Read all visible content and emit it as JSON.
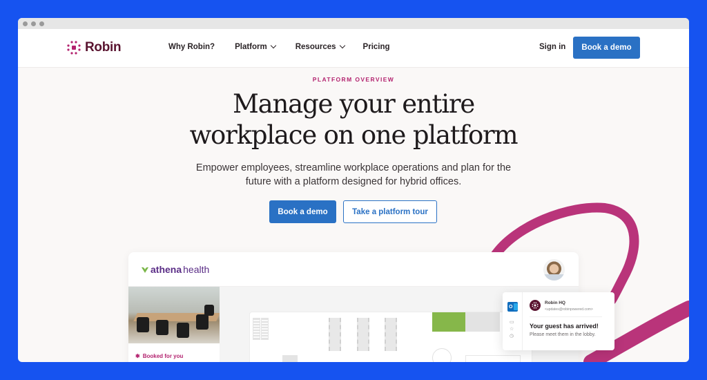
{
  "window": {
    "controls": [
      "close",
      "minimize",
      "maximize"
    ]
  },
  "nav": {
    "logo_text": "Robin",
    "links": [
      {
        "label": "Why Robin?",
        "has_dropdown": false
      },
      {
        "label": "Platform",
        "has_dropdown": true
      },
      {
        "label": "Resources",
        "has_dropdown": true
      },
      {
        "label": "Pricing",
        "has_dropdown": false
      }
    ],
    "sign_in": "Sign in",
    "cta": "Book a demo"
  },
  "hero": {
    "eyebrow": "PLATFORM OVERVIEW",
    "headline_line1": "Manage your entire",
    "headline_line2": "workplace on one platform",
    "subhead_line1": "Empower employees, streamline workplace operations and plan for the",
    "subhead_line2": "future with a platform designed for hybrid offices.",
    "primary_button": "Book a demo",
    "secondary_button": "Take a platform tour"
  },
  "app_preview": {
    "customer_logo_bold": "athena",
    "customer_logo_light": "health",
    "room_booking_label": "Booked for you",
    "notification": {
      "sender_name": "Robin HQ",
      "sender_email": "<updates@robinpowered.com>",
      "title": "Your guest has arrived!",
      "body": "Please meet them in the lobby.",
      "app_icon_letter": "O"
    }
  },
  "colors": {
    "background": "#1653f0",
    "brand": "#5a1430",
    "accent_magenta": "#b3236f",
    "button_blue": "#2a71c4",
    "booked_room_green": "#86b74a"
  }
}
